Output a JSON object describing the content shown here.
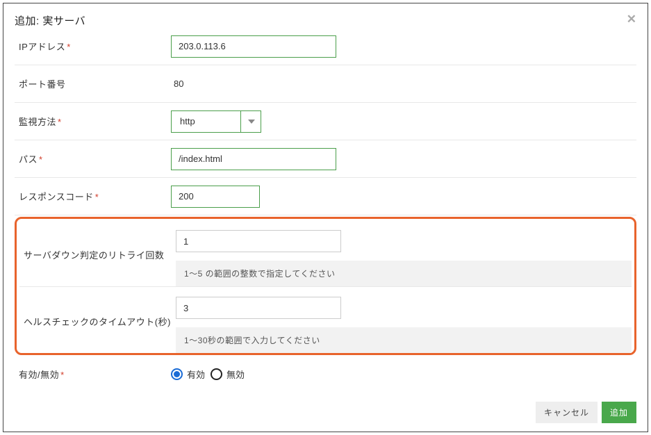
{
  "dialog": {
    "title": "追加: 実サーバ",
    "close_label": "閉じる"
  },
  "fields": {
    "ip": {
      "label": "IPアドレス",
      "value": "203.0.113.6"
    },
    "port": {
      "label": "ポート番号",
      "value": "80"
    },
    "monitor": {
      "label": "監視方法",
      "value": "http"
    },
    "path": {
      "label": "パス",
      "value": "/index.html"
    },
    "response": {
      "label": "レスポンスコード",
      "value": "200"
    },
    "retry": {
      "label": "サーバダウン判定のリトライ回数",
      "value": "1",
      "hint": "1〜5 の範囲の整数で指定してください"
    },
    "timeout": {
      "label": "ヘルスチェックのタイムアウト(秒)",
      "value": "3",
      "hint": "1〜30秒の範囲で入力してください"
    },
    "enabled": {
      "label": "有効/無効",
      "on": "有効",
      "off": "無効"
    }
  },
  "footer": {
    "cancel": "キャンセル",
    "submit": "追加"
  }
}
